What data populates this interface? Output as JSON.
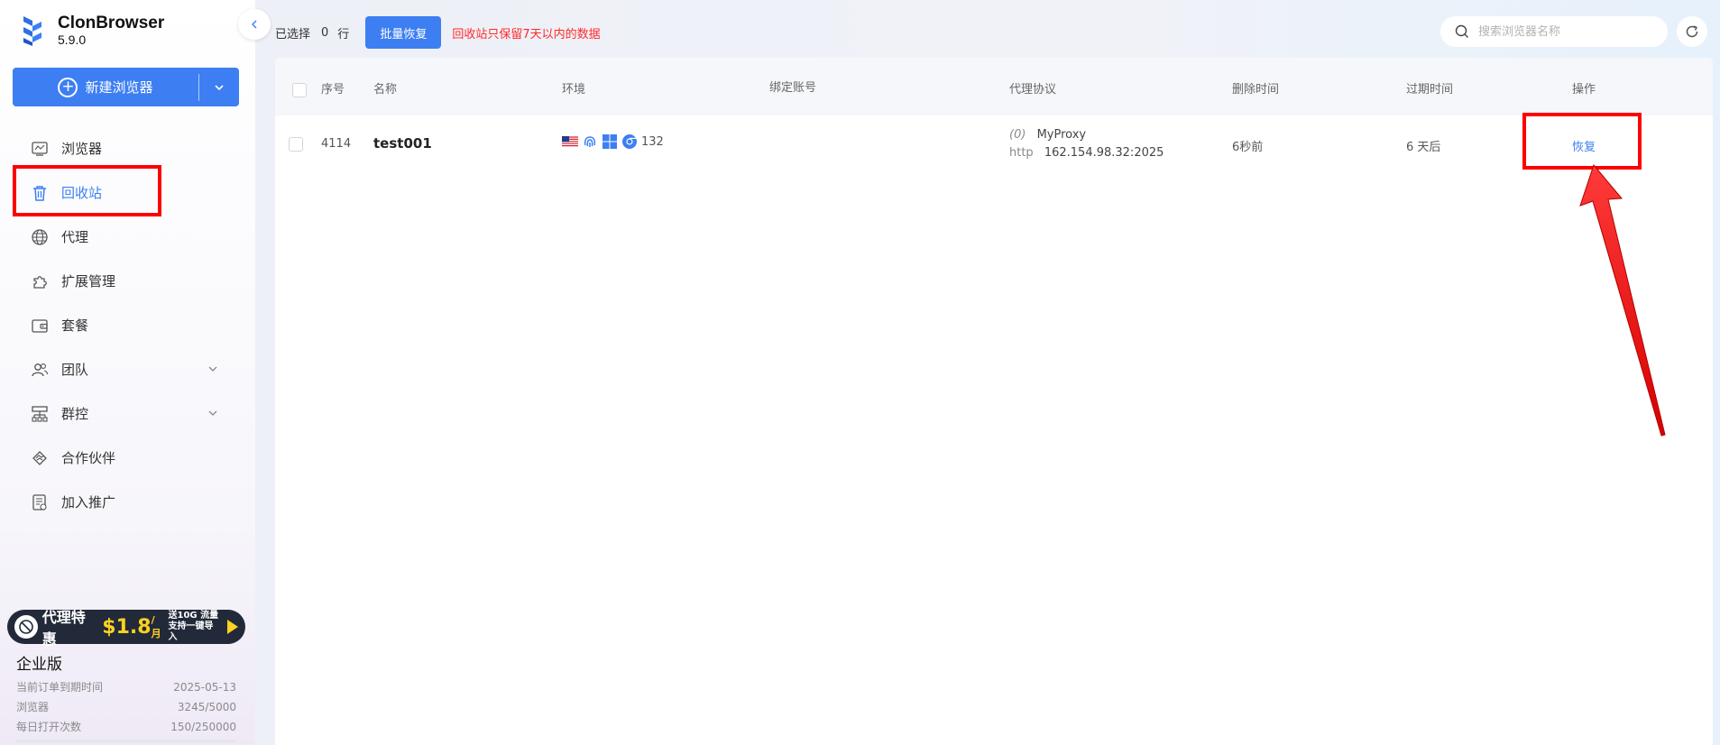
{
  "app": {
    "name": "ClonBrowser",
    "version": "5.9.0"
  },
  "sidebar": {
    "new_browser_label": "新建浏览器",
    "items": [
      {
        "label": "浏览器",
        "icon": "browser-icon"
      },
      {
        "label": "回收站",
        "icon": "trash-icon",
        "active": true
      },
      {
        "label": "代理",
        "icon": "globe-icon"
      },
      {
        "label": "扩展管理",
        "icon": "puzzle-icon"
      },
      {
        "label": "套餐",
        "icon": "wallet-icon"
      },
      {
        "label": "团队",
        "icon": "team-icon",
        "expandable": true
      },
      {
        "label": "群控",
        "icon": "hierarchy-icon",
        "expandable": true
      },
      {
        "label": "合作伙伴",
        "icon": "handshake-icon"
      },
      {
        "label": "加入推广",
        "icon": "promotion-icon"
      }
    ],
    "promo": {
      "title": "代理特惠",
      "price": "$1.8",
      "unit": "/月",
      "line1": "送10G 流量",
      "line2": "支持一键导入"
    },
    "plan": {
      "title": "企业版",
      "rows": [
        {
          "label": "当前订单到期时间",
          "value": "2025-05-13"
        },
        {
          "label": "浏览器",
          "value": "3245/5000"
        },
        {
          "label": "每日打开次数",
          "value": "150/250000"
        }
      ]
    }
  },
  "toolbar": {
    "selected_prefix": "已选择",
    "selected_count": "0",
    "selected_suffix": "行",
    "batch_restore_label": "批量恢复",
    "warning": "回收站只保留7天以内的数据",
    "search_placeholder": "搜索浏览器名称"
  },
  "table": {
    "columns": [
      "序号",
      "名称",
      "环境",
      "绑定账号",
      "代理协议",
      "删除时间",
      "过期时间",
      "操作"
    ],
    "rows": [
      {
        "id": "4114",
        "name": "test001",
        "env_version": "132",
        "bound_account": "",
        "proxy_count": "(0)",
        "proxy_name": "MyProxy",
        "proxy_type": "http",
        "proxy_addr": "162.154.98.32:2025",
        "deleted": "6秒前",
        "expires": "6 天后",
        "action": "恢复"
      }
    ]
  },
  "colors": {
    "accent": "#3d7ff2",
    "highlight": "#ff0000",
    "warning": "#ff2a2a"
  }
}
